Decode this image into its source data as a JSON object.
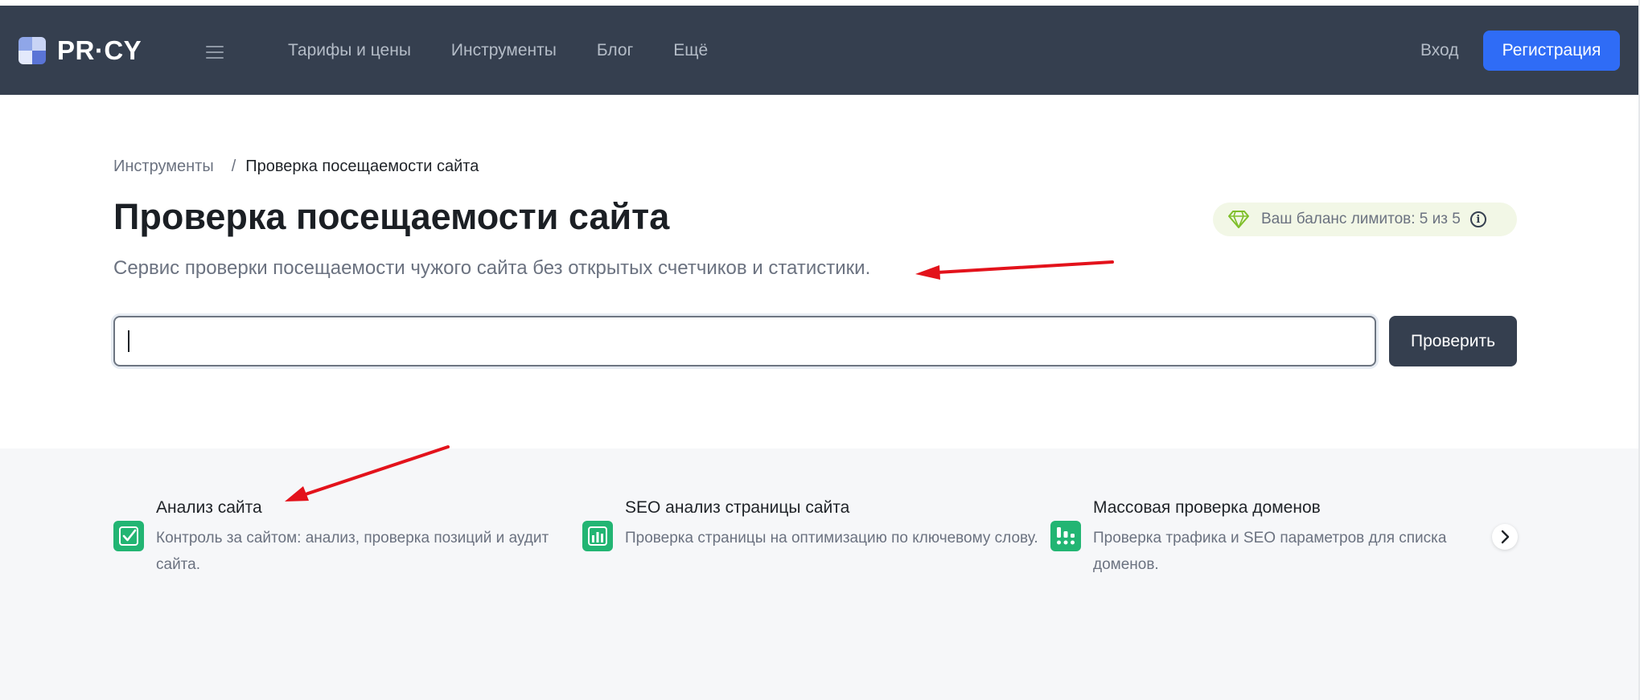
{
  "header": {
    "logo_text": "PR·CY",
    "nav": [
      "Тарифы и цены",
      "Инструменты",
      "Блог",
      "Ещё"
    ],
    "login_label": "Вход",
    "register_label": "Регистрация",
    "brand_color": "#353f4f",
    "accent_color": "#2f6cf6"
  },
  "breadcrumb": {
    "parent": "Инструменты",
    "separator": "/",
    "current": "Проверка посещаемости сайта"
  },
  "page": {
    "title": "Проверка посещаемости сайта",
    "subtitle": "Сервис проверки посещаемости чужого сайта без открытых счетчиков и статистики.",
    "balance_text": "Ваш баланс лимитов: 5 из 5",
    "balance_icon": "diamond-icon",
    "info_glyph": "i"
  },
  "search": {
    "value": "",
    "placeholder": "",
    "button_label": "Проверить"
  },
  "tools": [
    {
      "title": "Анализ сайта",
      "description": "Контроль за сайтом: анализ, проверка позиций и аудит сайта.",
      "icon": "checkmark-icon"
    },
    {
      "title": "SEO анализ страницы сайта",
      "description": "Проверка страницы на оптимизацию по ключевому слову.",
      "icon": "bar-chart-icon"
    },
    {
      "title": "Массовая проверка доменов",
      "description": "Проверка трафика и SEO параметров для списка доменов.",
      "icon": "dots-grid-icon"
    }
  ],
  "annotation_color": "#e3121b"
}
